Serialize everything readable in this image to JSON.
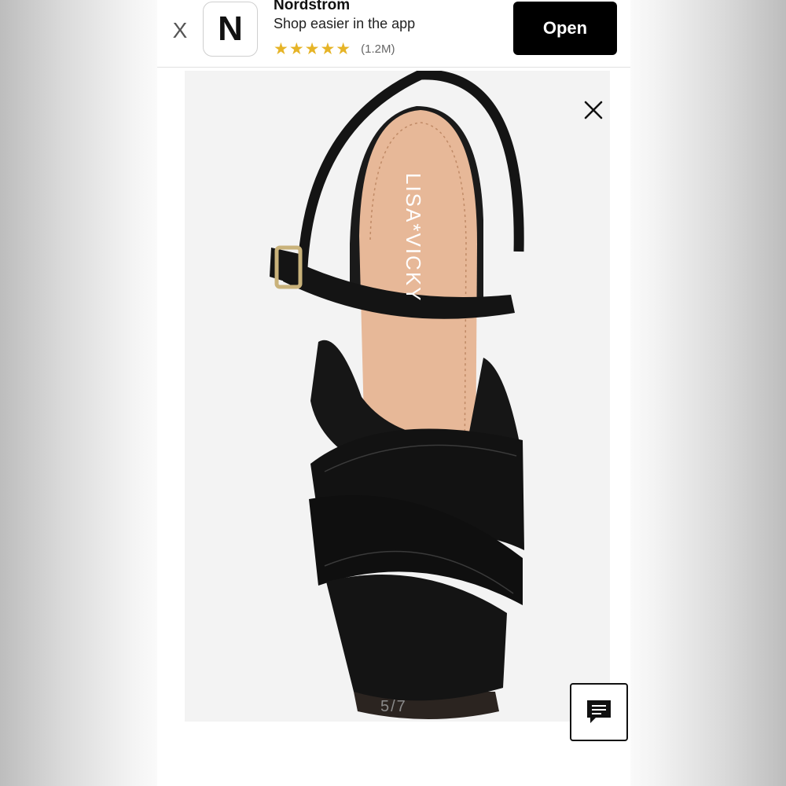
{
  "app_banner": {
    "close_label": "X",
    "icon_letter": "N",
    "app_name": "Nordstrom",
    "tagline": "Shop easier in the app",
    "stars": "★★★★★",
    "rating_count": "(1.2M)",
    "open_label": "Open"
  },
  "product": {
    "insole_brand": "LISA*VICKY",
    "page_indicator": "5/7"
  },
  "icons": {
    "banner_close": "close-icon",
    "image_close": "close-icon",
    "chat": "chat-icon"
  },
  "colors": {
    "star": "#e6b427",
    "open_button_bg": "#000000",
    "image_bg": "#f3f3f3",
    "suede": "#141414",
    "insole": "#e7b898"
  }
}
